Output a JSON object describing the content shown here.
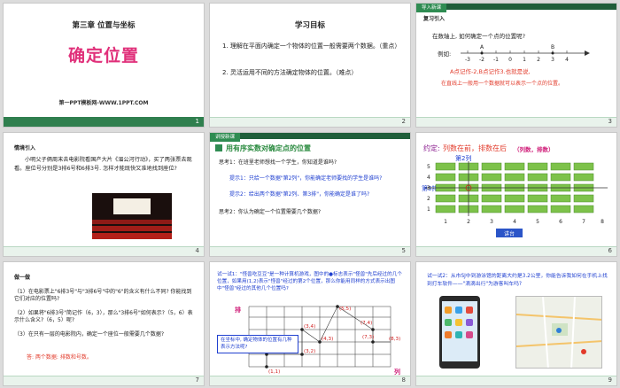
{
  "slides": [
    {
      "num": "1",
      "chapter": "第三章  位置与坐标",
      "title": "确定位置",
      "footer": "第一PPT模板网-WWW.1PPT.COM"
    },
    {
      "num": "2",
      "heading": "学习目标",
      "goal1": "1. 理解在平面内确定一个物体的位置一般需要两个数据。（重点）",
      "goal2": "2. 灵活运用不同的方法确定物体的位置。（难点）"
    },
    {
      "num": "3",
      "badge": "导入新课",
      "section": "复习引入",
      "question": "在数轴上, 如何确定一个点的位置呢?",
      "example": "例如:",
      "point_a": "A",
      "point_b": "B",
      "ticks": [
        "-3",
        "-2",
        "-1",
        "0",
        "1",
        "2",
        "3",
        "4"
      ],
      "answer": "A点记作-2,B点记作3.也就是说,",
      "answer2": "在直线上一般用一个数据就可以表示一个点的位置。"
    },
    {
      "num": "4",
      "section": "情境引入",
      "story": "小明父子俩周末去电影院看国产大片《湄公河行动》，买了两张票去观看。座位号分别是3排6号和6排3号. 怎样才能既快又准地找到座位?"
    },
    {
      "num": "5",
      "badge": "讲授新课",
      "heading": "用有序实数对确定点的位置",
      "think1": "思考1：在班里老师想找一个学生，你知道是谁吗?",
      "hint1": "提示1：只给一个数据\"第2列\"，你能确定老师要找的学生是谁吗?",
      "hint2": "提示2：给出两个数据\"第2列、第3排\"，你能确定是谁了吗?",
      "think2": "思考2：你认为确定一个位置需要几个数据?"
    },
    {
      "num": "6",
      "agreement_prefix": "约定:",
      "agreement_mid": "列数在前，排数在后",
      "agreement_suffix": "（列数，排数）",
      "col_label": "第2列",
      "row_label": "第3排",
      "row_nums": [
        "5",
        "4",
        "3",
        "2",
        "1"
      ],
      "col_nums": [
        "1",
        "2",
        "3",
        "4",
        "5",
        "6",
        "7",
        "8"
      ],
      "podium": "讲台"
    },
    {
      "num": "7",
      "section": "做一做",
      "q1": "（1）在电影票上\"6排3号\"与\"3排6号\"中的\"6\"的含义有什么不同? 你能找到它们对应的位置吗?",
      "q2": "（2）如果将\"6排3号\"简记作（6，3），那么\"3排6号\"如何表示?（5，6）表示什么含义?（6，5）呢?",
      "q3": "（3）在只有一层的电影院内，确定一个座位一般需要几个数据?",
      "answer": "答: 两个数据: 排数和号数。"
    },
    {
      "num": "8",
      "problem": "试一试1：\"怪兽吃豆豆\"是一种计算机游戏，图中的●标志表示\"怪兽\"先后经过的几个位置，如果用(1,2)表示\"怪兽\"经过的第2个位置，那么你能用同样的方式表示出图中\"怪兽\"经过的其他几个位置吗?",
      "axis_row": "排",
      "axis_col": "列",
      "callout": "在坐标中, 确定物体的位置有几种表示方法呢?",
      "points": [
        "(1,1)",
        "(1,2)",
        "(3,2)",
        "(3,4)",
        "(4,3)",
        "(5,5)",
        "(7,4)",
        "(7,3)",
        "(8,3)"
      ]
    },
    {
      "num": "9",
      "problem": "试一试2：从市SJ中到游泳馆的距离大约是3.2公里，你能告诉我如何在手机上找到打车软件——\"滴滴出行\"为游客叫车吗?"
    }
  ]
}
